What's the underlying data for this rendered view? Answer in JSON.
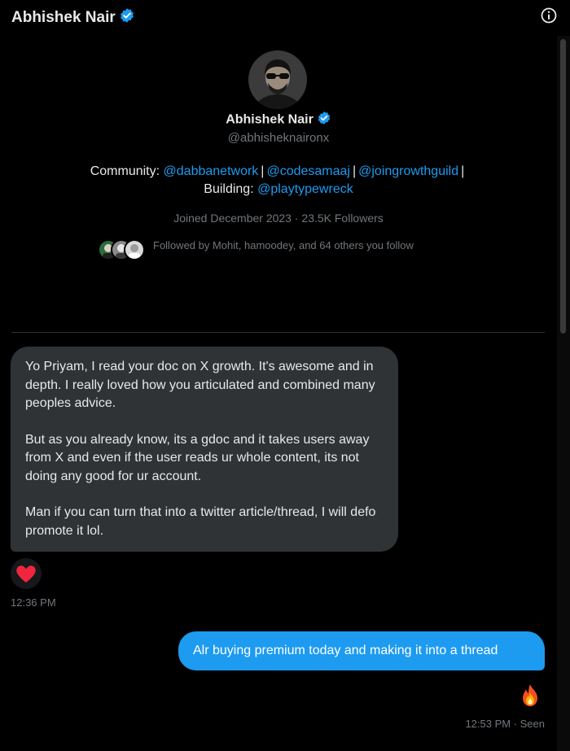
{
  "header": {
    "title": "Abhishek Nair",
    "verified_icon": "verified-badge-icon",
    "info_icon": "info-icon"
  },
  "profile": {
    "name": "Abhishek Nair",
    "handle": "@abhisheknaironx",
    "bio": {
      "community_label": "Community:",
      "links": [
        "@dabbanetwork",
        "@codesamaaj",
        "@joingrowthguild"
      ],
      "separator": "|",
      "building_label": "Building:",
      "building_link": "@playtypewreck"
    },
    "joined": "Joined December 2023 · 23.5K Followers",
    "followed_by": "Followed by Mohit, hamoodey, and 64 others you follow"
  },
  "messages": {
    "incoming": {
      "paragraphs": [
        "Yo Priyam, I read your doc on X growth. It's awesome and in depth. I really loved how you articulated and combined many peoples advice.",
        "But as you already know, its a gdoc and it takes users away from X and even if the user reads ur whole content, its not doing any good for ur account.",
        "Man if you can turn that into a twitter article/thread, I will defo promote it lol."
      ],
      "reaction": "heart-icon",
      "time": "12:36 PM"
    },
    "outgoing": {
      "text": "Alr buying premium today and making it into a thread",
      "reaction": "fire-icon",
      "status": "12:53 PM · Seen"
    }
  },
  "colors": {
    "background": "#000000",
    "accent": "#1d9bf0",
    "bubble_incoming": "#2f3336",
    "muted_text": "#71767b"
  }
}
